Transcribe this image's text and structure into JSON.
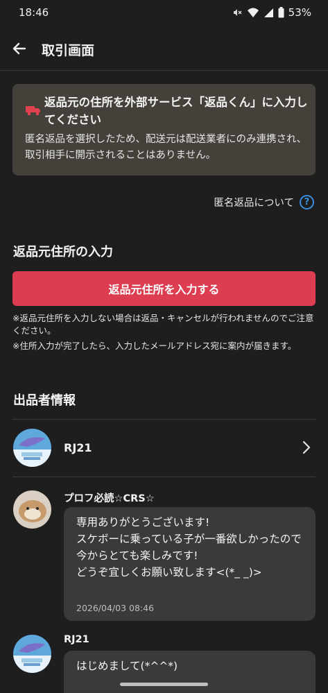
{
  "status_bar": {
    "time": "18:46",
    "battery": "53%"
  },
  "app_bar": {
    "title": "取引画面"
  },
  "notice": {
    "title": "返品元の住所を外部サービス「返品くん」に入力してください",
    "body": "匿名返品を選択したため、配送元は配送業者にのみ連携され、取引相手に開示されることはありません。"
  },
  "anon_link": {
    "label": "匿名返品について"
  },
  "address_section": {
    "heading": "返品元住所の入力",
    "button_label": "返品元住所を入力する",
    "note1": "※返品元住所を入力しない場合は返品・キャンセルが行われませんのでご注意ください。",
    "note2": "※住所入力が完了したら、入力したメールアドレス宛に案内が届きます。"
  },
  "seller_section": {
    "heading": "出品者情報",
    "seller_name": "RJ21"
  },
  "comments": [
    {
      "name": "プロフ必読☆CRS☆",
      "text": "専用ありがとうございます!\nスケボーに乗っている子が一番欲しかったので\n今からとても楽しみです!\nどうぞ宜しくお願い致します<(*_ _)>",
      "time": "2026/04/03 08:46"
    },
    {
      "name": "RJ21",
      "text": "はじめまして(*^^*)",
      "time": ""
    }
  ],
  "colors": {
    "accent": "#dc3d50",
    "link_blue": "#3b8fe0",
    "notice_bg": "#44413b",
    "bubble_bg": "#3a3a3a",
    "background": "#1e1e1e"
  },
  "icons": [
    "mute-icon",
    "wifi-icon",
    "signal-icon",
    "battery-icon",
    "back-arrow-icon",
    "truck-icon",
    "help-icon",
    "chevron-right-icon"
  ]
}
